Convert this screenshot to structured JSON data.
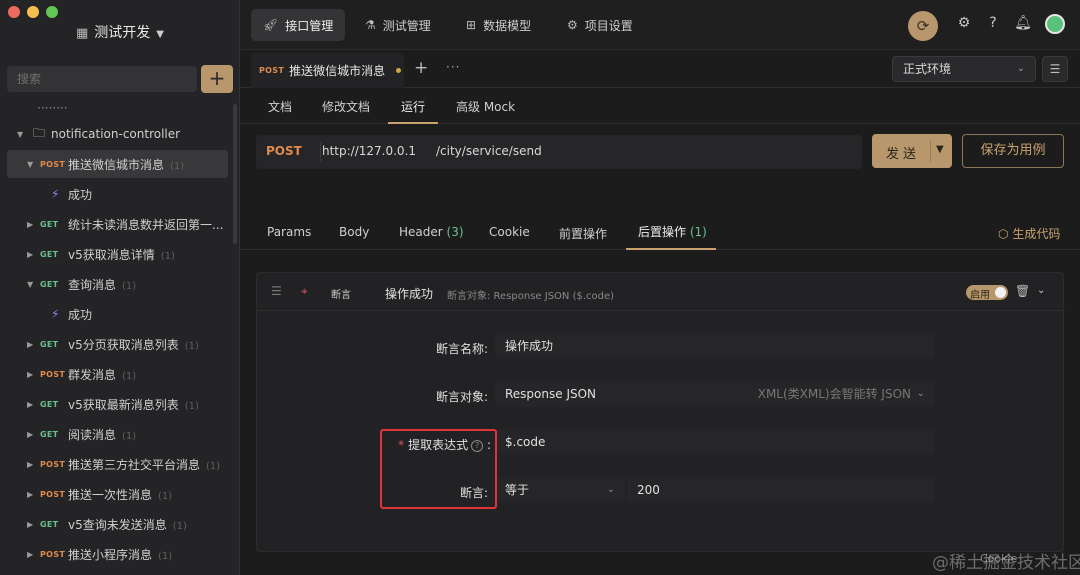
{
  "window": {
    "traffic_colors": [
      "#ed6a5e",
      "#f5bf4f",
      "#62c554"
    ]
  },
  "sidebar": {
    "project_title": "测试开发",
    "search_placeholder": "搜索",
    "add_label": "+",
    "clipped_item": "········",
    "folder": "notification-controller",
    "items": [
      {
        "method": "POST",
        "label": "推送微信城市消息",
        "count": "(1)",
        "active": true
      },
      {
        "label": "成功",
        "case": true
      },
      {
        "method": "GET",
        "label": "统计未读消息数并返回第一...",
        "count": ""
      },
      {
        "method": "GET",
        "label": "v5获取消息详情",
        "count": "(1)"
      },
      {
        "method": "GET",
        "label": "查询消息",
        "count": "(1)"
      },
      {
        "label": "成功",
        "case": true
      },
      {
        "method": "GET",
        "label": "v5分页获取消息列表",
        "count": "(1)"
      },
      {
        "method": "POST",
        "label": "群发消息",
        "count": "(1)"
      },
      {
        "method": "GET",
        "label": "v5获取最新消息列表",
        "count": "(1)"
      },
      {
        "method": "GET",
        "label": "阅读消息",
        "count": "(1)"
      },
      {
        "method": "POST",
        "label": "推送第三方社交平台消息",
        "count": "(1)"
      },
      {
        "method": "POST",
        "label": "推送一次性消息",
        "count": "(1)"
      },
      {
        "method": "GET",
        "label": "v5查询未发送消息",
        "count": "(1)"
      },
      {
        "method": "POST",
        "label": "推送小程序消息",
        "count": "(1)"
      }
    ]
  },
  "topbar": {
    "tabs": [
      "接口管理",
      "测试管理",
      "数据模型",
      "项目设置"
    ]
  },
  "req_tab": {
    "method": "POST",
    "title": "推送微信城市消息",
    "plus": "+",
    "more": "···"
  },
  "env": {
    "selected": "正式环境"
  },
  "sub_tabs": [
    "文档",
    "修改文档",
    "运行",
    "高级 Mock"
  ],
  "url": {
    "method": "POST",
    "base": "http://127.0.0.1",
    "path": "/city/service/send",
    "send": "发送",
    "save_case": "保存为用例"
  },
  "param_tabs": {
    "params": "Params",
    "body": "Body",
    "header": "Header",
    "header_count": "(3)",
    "cookie": "Cookie",
    "pre": "前置操作",
    "post": "后置操作",
    "post_count": "(1)",
    "gen_code": "生成代码"
  },
  "assertion": {
    "type_label": "断言",
    "name": "操作成功",
    "desc": "断言对象: Response JSON ($.code)",
    "toggle": "启用",
    "fields": {
      "name_label": "断言名称:",
      "name_value": "操作成功",
      "target_label": "断言对象:",
      "target_value": "Response JSON",
      "target_hint": "XML(类XML)会智能转 JSON",
      "expr_label": "提取表达式",
      "expr_value": "$.code",
      "assert_label": "断言:",
      "op_value": "等于",
      "expected_value": "200"
    }
  },
  "watermark": {
    "text": "@稀土掘金技术社区",
    "cookie": "Cookie"
  }
}
